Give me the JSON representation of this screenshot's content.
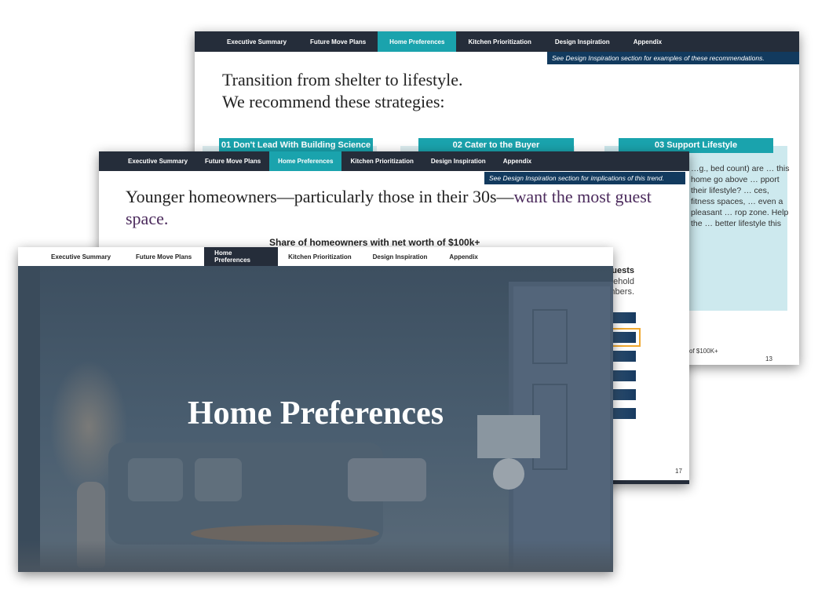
{
  "nav_items": [
    "Executive Summary",
    "Future Move Plans",
    "Home Preferences",
    "Kitchen Prioritization",
    "Design Inspiration",
    "Appendix"
  ],
  "slide_back": {
    "note": "See Design Inspiration section for examples of these recommendations.",
    "title_line1": "Transition from shelter to lifestyle.",
    "title_line2": "We recommend these strategies:",
    "strategies": [
      "01 Don't Lead With Building Science",
      "02 Cater to the Buyer",
      "03 Support Lifestyle"
    ],
    "body_fragment": "…g., bed count) are … this home go above … pport their lifestyle? … ces, fitness spaces, … even a pleasant … rop zone. Help the … better lifestyle this",
    "footnote_fragment": "of $100K+",
    "page": "13"
  },
  "slide_middle": {
    "note": "See Design Inspiration section for implications of this trend.",
    "title_plain": "Younger homeowners—particularly those in their 30s—",
    "title_highlight": "want the most guest space.",
    "chart_title": "Share of homeowners with net worth of $100k+",
    "side_text_bold": "uests",
    "side_text": "space ehold nbers.",
    "page": "17"
  },
  "slide_front": {
    "title": "Home Preferences"
  },
  "colors": {
    "nav_dark": "#252d3a",
    "teal": "#1aa3ad",
    "navy": "#123a5e",
    "purple": "#4b2a5c",
    "highlight": "#f0a830"
  }
}
